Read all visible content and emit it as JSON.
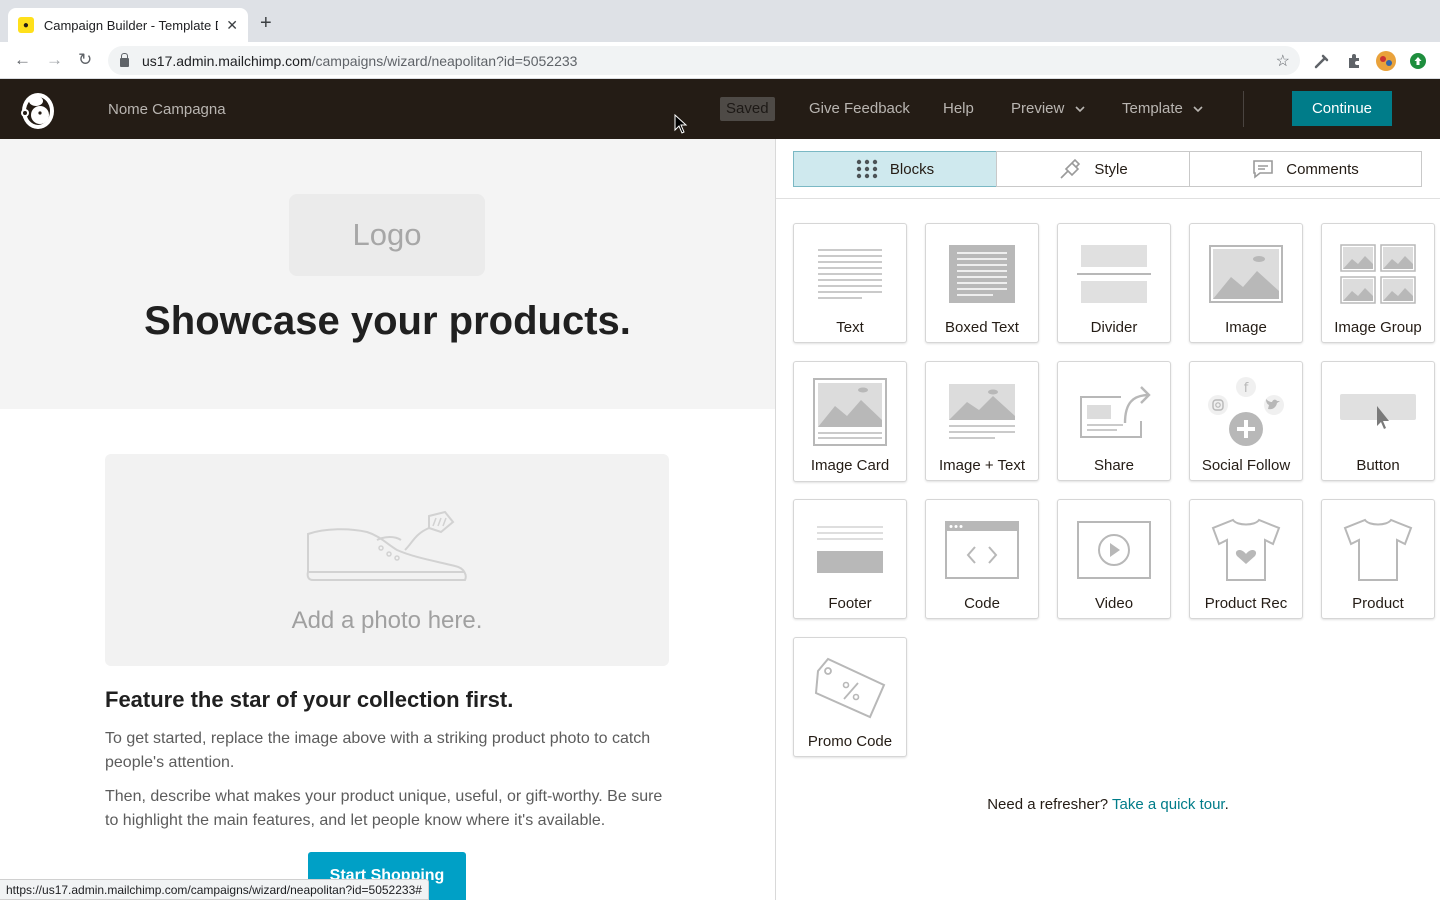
{
  "browser": {
    "tab_title": "Campaign Builder - Template D",
    "url_host": "us17.admin.mailchimp.com",
    "url_path": "/campaigns/wizard/neapolitan?id=5052233",
    "status_url": "https://us17.admin.mailchimp.com/campaigns/wizard/neapolitan?id=5052233#"
  },
  "header": {
    "campaign_name": "Nome Campagna",
    "saved": "Saved",
    "give_feedback": "Give Feedback",
    "help": "Help",
    "preview": "Preview",
    "template": "Template",
    "continue": "Continue",
    "brand_color": "#241c15",
    "accent_color": "#007c89"
  },
  "email": {
    "logo_placeholder": "Logo",
    "hero_title": "Showcase your products.",
    "photo_placeholder": "Add a photo here.",
    "feature_title": "Feature the star of your collection first.",
    "paragraph_1": "To get started, replace the image above with a striking product photo to catch people's attention.",
    "paragraph_2": "Then, describe what makes your product unique, useful, or gift-worthy. Be sure to highlight the main features, and let people know where it's available.",
    "cta": "Start Shopping"
  },
  "panel": {
    "tabs": [
      {
        "label": "Blocks",
        "icon": "grid-icon",
        "active": true
      },
      {
        "label": "Style",
        "icon": "paint-brush-icon",
        "active": false
      },
      {
        "label": "Comments",
        "icon": "comment-icon",
        "active": false
      }
    ],
    "blocks": [
      {
        "label": "Text",
        "icon": "text-block-icon"
      },
      {
        "label": "Boxed Text",
        "icon": "boxed-text-block-icon"
      },
      {
        "label": "Divider",
        "icon": "divider-block-icon"
      },
      {
        "label": "Image",
        "icon": "image-block-icon"
      },
      {
        "label": "Image Group",
        "icon": "image-group-block-icon"
      },
      {
        "label": "Image Card",
        "icon": "image-card-block-icon"
      },
      {
        "label": "Image + Text",
        "icon": "image-text-block-icon"
      },
      {
        "label": "Share",
        "icon": "share-block-icon"
      },
      {
        "label": "Social Follow",
        "icon": "social-follow-block-icon"
      },
      {
        "label": "Button",
        "icon": "button-block-icon"
      },
      {
        "label": "Footer",
        "icon": "footer-block-icon"
      },
      {
        "label": "Code",
        "icon": "code-block-icon"
      },
      {
        "label": "Video",
        "icon": "video-block-icon"
      },
      {
        "label": "Product Rec",
        "icon": "product-rec-block-icon"
      },
      {
        "label": "Product",
        "icon": "product-block-icon"
      },
      {
        "label": "Promo Code",
        "icon": "promo-code-block-icon"
      }
    ],
    "refresher_text": "Need a refresher?",
    "refresher_link": "Take a quick tour",
    "refresher_end": "."
  }
}
